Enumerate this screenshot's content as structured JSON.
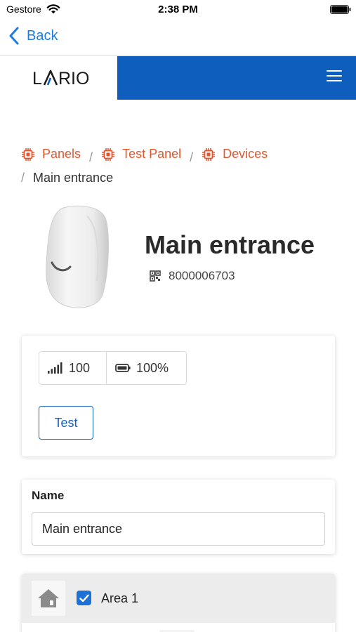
{
  "status_bar": {
    "carrier": "Gestore",
    "time": "2:38 PM",
    "wifi_icon": "wifi-icon",
    "battery_icon": "battery-icon"
  },
  "nav": {
    "back_label": "Back",
    "back_icon": "chevron-left-icon"
  },
  "header": {
    "logo_text": "LARIO",
    "menu_icon": "hamburger-menu-icon",
    "brand_color": "#0e5fbd"
  },
  "breadcrumb": {
    "items": [
      {
        "label": "Panels",
        "icon": "chip-icon"
      },
      {
        "label": "Test Panel",
        "icon": "chip-icon"
      },
      {
        "label": "Devices",
        "icon": "chip-icon"
      }
    ],
    "separator": "/",
    "current": "Main entrance",
    "link_color": "#e4552b"
  },
  "device": {
    "title": "Main entrance",
    "serial": "8000006703",
    "serial_icon": "qr-code-icon",
    "image": "motion-sensor-image"
  },
  "status": {
    "signal_value": "100",
    "signal_icon": "signal-bars-icon",
    "battery_value": "100%",
    "battery_icon": "battery-icon",
    "test_label": "Test"
  },
  "name_form": {
    "label": "Name",
    "value": "Main entrance"
  },
  "areas": [
    {
      "label": "Area 1",
      "checked": true,
      "icon": "house-icon"
    }
  ]
}
